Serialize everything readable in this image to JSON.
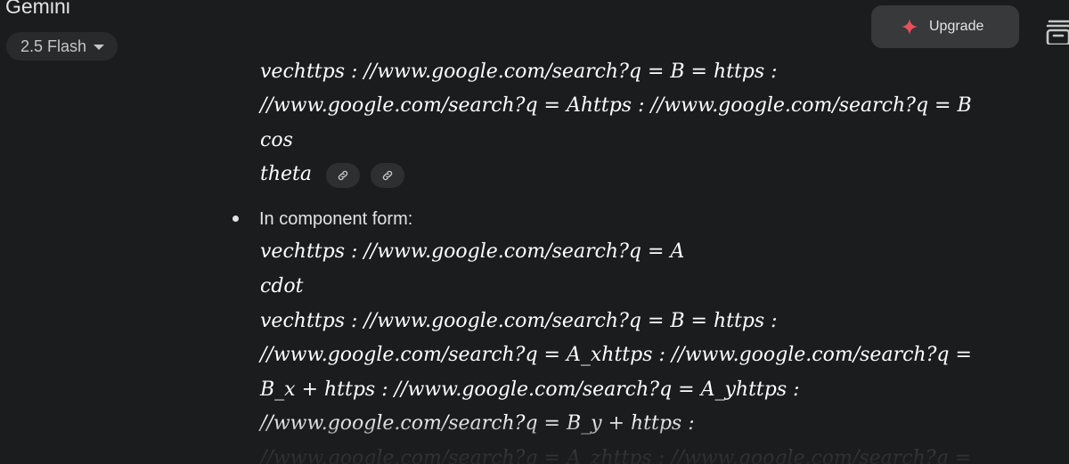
{
  "header": {
    "app_title": "Gemini",
    "model_label": "2.5 Flash",
    "upgrade_label": "Upgrade",
    "icons": {
      "model_chevron": "chevron-down-icon",
      "upgrade": "sparkle-icon",
      "stack": "stack-icon"
    },
    "colors": {
      "background": "#1b1c1d",
      "button_bg": "#37393b",
      "sparkle": "#e8505b"
    }
  },
  "response": {
    "top_lines": [
      "vechttps : //www.google.com/search?q = B = https :",
      "//www.google.com/search?q = Ahttps : //www.google.com/search?q = B",
      "cos",
      "theta"
    ],
    "source_chips": [
      {
        "icon": "link-icon"
      },
      {
        "icon": "link-icon"
      }
    ],
    "bullet": {
      "text": "In component form:",
      "lines": [
        "vechttps : //www.google.com/search?q = A",
        "cdot",
        "vechttps : //www.google.com/search?q = B = https :",
        "//www.google.com/search?q = A_xhttps : //www.google.com/search?q =",
        "B_x + https : //www.google.com/search?q = A_yhttps :",
        "//www.google.com/search?q = B_y + https :",
        "//www.google.com/search?q = A_zhttps : //www.google.com/search?q ="
      ]
    }
  }
}
